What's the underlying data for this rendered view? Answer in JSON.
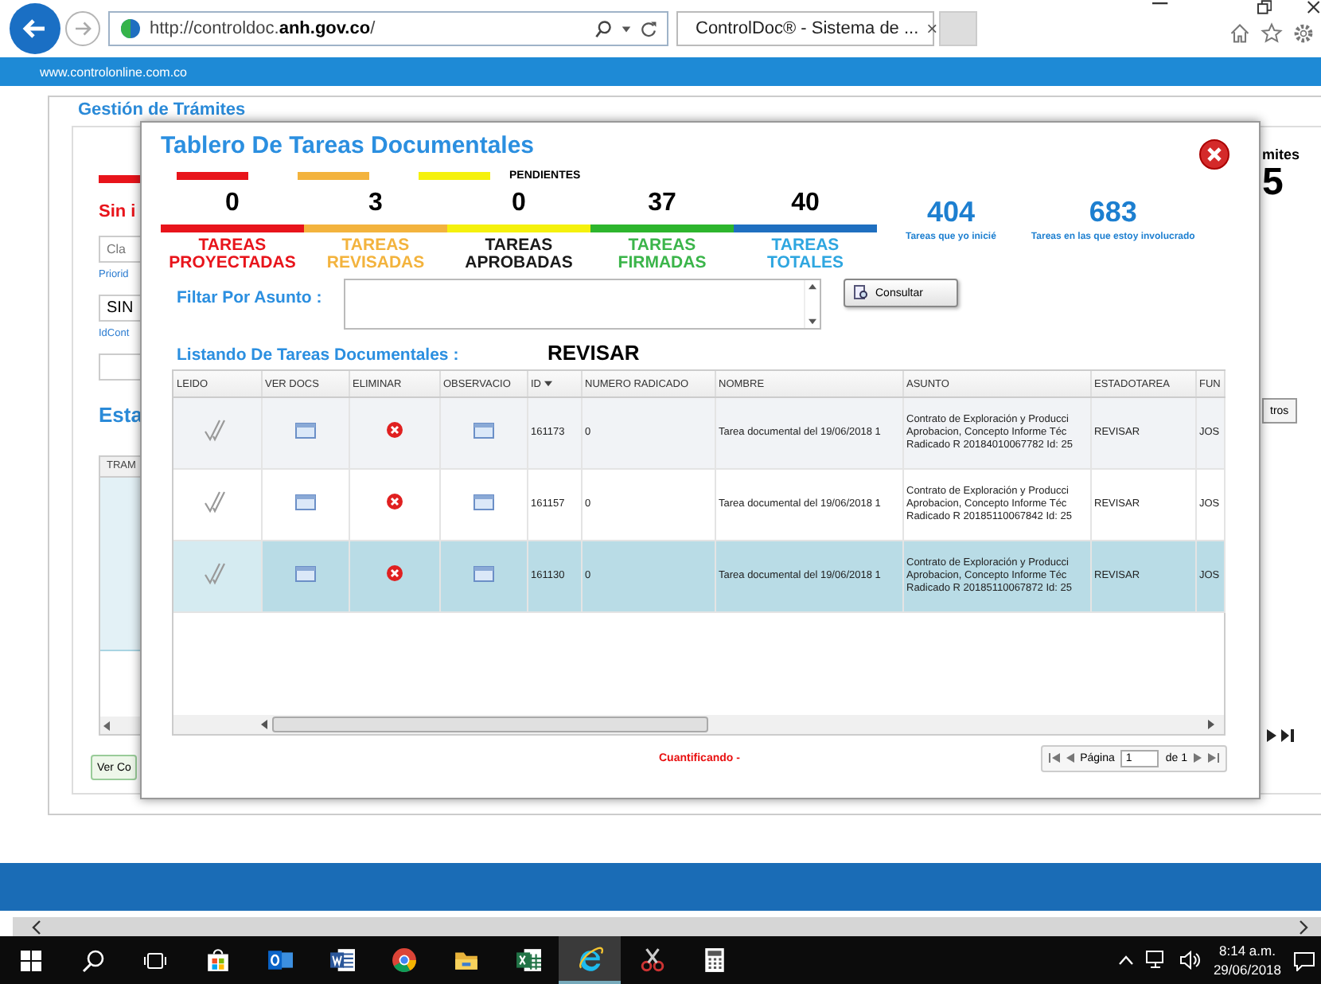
{
  "browser": {
    "url": "http://controldoc.**anh.gov.co**/",
    "tab_title": "ControlDoc® - Sistema de ...",
    "tab_close": "×"
  },
  "site_header": {
    "text": "www.controlonline.com.co"
  },
  "background_page": {
    "title": "Gestión de Trámites",
    "left": [
      {
        "kind": "heading",
        "text": "Sin i"
      },
      {
        "kind": "field",
        "placeholder": "Cla"
      },
      {
        "kind": "label",
        "text": "Priorid"
      },
      {
        "kind": "field",
        "value": "SIN"
      },
      {
        "kind": "label",
        "text": "IdCont"
      },
      {
        "kind": "field"
      },
      {
        "kind": "section",
        "text": "Esta"
      },
      {
        "kind": "grid",
        "text": "TRAM"
      },
      {
        "kind": "button",
        "text": "Ver Co"
      }
    ],
    "right": [
      {
        "kind": "heading",
        "text": "mites"
      },
      {
        "kind": "count",
        "text": "5"
      },
      {
        "kind": "button",
        "text": "tros"
      },
      {
        "kind": "pager"
      }
    ]
  },
  "modal": {
    "title": "Tablero De Tareas Documentales",
    "pending_label": "PENDIENTES",
    "counters": [
      {
        "count": "0",
        "label": {
          "text": "TAREAS PROYECTADAS",
          "color": "#e8141b"
        },
        "color": "#e8141b",
        "pending": true
      },
      {
        "count": "3",
        "label": {
          "text": "TAREAS REVISADAS",
          "color": "#f3b33d"
        },
        "color": "#f3b33d",
        "pending": true
      },
      {
        "count": "0",
        "label": {
          "text": "TAREAS APROBADAS",
          "color": "#1a1a1a"
        },
        "color": "#f5f10c",
        "pending": true
      },
      {
        "count": "37",
        "label": {
          "text": "TAREAS FIRMADAS",
          "color": "#3bb54a"
        },
        "color": "#2db52d",
        "pending": false
      },
      {
        "count": "40",
        "label": {
          "text": "TAREAS TOTALES",
          "color": "#2ea6e0"
        },
        "color": "#1f6fc0",
        "pending": false
      }
    ],
    "stats": [
      {
        "count": "404",
        "label": "Tareas que yo inicié"
      },
      {
        "count": "683",
        "label": "Tareas en las que estoy involucrado"
      }
    ],
    "filter": {
      "label": "Filtar Por Asunto :",
      "button": "Consultar"
    },
    "listing": {
      "label": "Listando De Tareas Documentales :",
      "status": "REVISAR"
    },
    "table": {
      "columns": [
        {
          "label": "LEIDO",
          "sorted": false
        },
        {
          "label": "VER DOCS",
          "sorted": false
        },
        {
          "label": "ELIMINAR",
          "sorted": false
        },
        {
          "label": "OBSERVACIO",
          "sorted": false
        },
        {
          "label": "ID",
          "sorted": true
        },
        {
          "label": "NUMERO RADICADO",
          "sorted": false
        },
        {
          "label": "NOMBRE",
          "sorted": false
        },
        {
          "label": "ASUNTO",
          "sorted": false
        },
        {
          "label": "ESTADOTAREA",
          "sorted": false
        },
        {
          "label": "FUN",
          "sorted": false
        }
      ],
      "rows": [
        {
          "selected": false,
          "id": "161173",
          "numero_radicado": "0",
          "nombre": "Tarea documental del 19/06/2018 1",
          "asunto": "Contrato de Exploración y Producci\nAprobacion, Concepto Informe Téc\nRadicado R 20184010067782 Id: 25",
          "estado": "REVISAR",
          "fun": "JOS"
        },
        {
          "selected": false,
          "id": "161157",
          "numero_radicado": "0",
          "nombre": "Tarea documental del 19/06/2018 1",
          "asunto": "Contrato de Exploración y Producci\nAprobacion, Concepto Informe Téc\nRadicado R 20185110067842 Id: 25",
          "estado": "REVISAR",
          "fun": "JOS"
        },
        {
          "selected": true,
          "id": "161130",
          "numero_radicado": "0",
          "nombre": "Tarea documental del 19/06/2018 1",
          "asunto": "Contrato de Exploración y Producci\nAprobacion, Concepto Informe Téc\nRadicado R 20185110067872 Id: 25",
          "estado": "REVISAR",
          "fun": "JOS"
        }
      ]
    },
    "footer": {
      "status": "Cuantificando -",
      "page_label": "Página",
      "page": "1",
      "of": "de 1"
    }
  },
  "taskbar": {
    "apps": [
      {
        "kind": "store",
        "selected": false
      },
      {
        "kind": "mail",
        "selected": false
      },
      {
        "kind": "word",
        "selected": false
      },
      {
        "kind": "chrome",
        "selected": false
      },
      {
        "kind": "files",
        "selected": false
      },
      {
        "kind": "excel",
        "selected": false
      },
      {
        "kind": "ie",
        "selected": true
      },
      {
        "kind": "snip",
        "selected": false
      },
      {
        "kind": "calc",
        "selected": false
      }
    ],
    "time": "8:14 a.m.",
    "date": "29/06/2018"
  }
}
